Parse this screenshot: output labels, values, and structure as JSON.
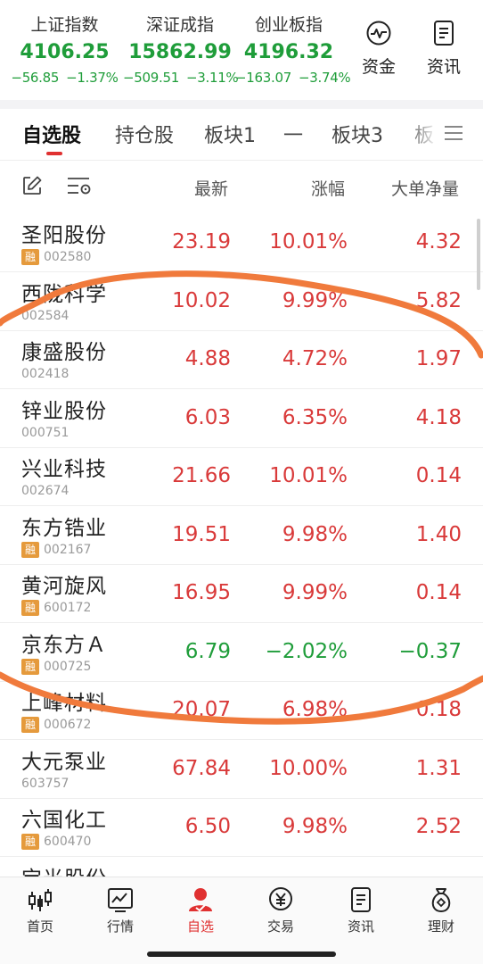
{
  "indices": [
    {
      "name": "上证指数",
      "value": "4106.25",
      "change": "−56.85",
      "pct": "−1.37%"
    },
    {
      "name": "深证成指",
      "value": "15862.99",
      "change": "−509.51",
      "pct": "−3.11%"
    },
    {
      "name": "创业板指",
      "value": "4196.32",
      "change": "−163.07",
      "pct": "−3.74%"
    }
  ],
  "quick": {
    "funds": "资金",
    "news": "资讯"
  },
  "tabs": [
    "自选股",
    "持仓股",
    "板块1",
    "一",
    "板块3",
    "板"
  ],
  "columns": {
    "latest": "最新",
    "change": "涨幅",
    "big_net": "大单净量"
  },
  "stocks": [
    {
      "name": "圣阳股份",
      "margin": "融",
      "code": "002580",
      "price": "23.19",
      "pct": "10.01%",
      "net": "4.32",
      "trend": "up"
    },
    {
      "name": "西陇科学",
      "margin": "",
      "code": "002584",
      "price": "10.02",
      "pct": "9.99%",
      "net": "5.82",
      "trend": "up"
    },
    {
      "name": "康盛股份",
      "margin": "",
      "code": "002418",
      "price": "4.88",
      "pct": "4.72%",
      "net": "1.97",
      "trend": "up"
    },
    {
      "name": "锌业股份",
      "margin": "",
      "code": "000751",
      "price": "6.03",
      "pct": "6.35%",
      "net": "4.18",
      "trend": "up"
    },
    {
      "name": "兴业科技",
      "margin": "",
      "code": "002674",
      "price": "21.66",
      "pct": "10.01%",
      "net": "0.14",
      "trend": "up"
    },
    {
      "name": "东方锆业",
      "margin": "融",
      "code": "002167",
      "price": "19.51",
      "pct": "9.98%",
      "net": "1.40",
      "trend": "up"
    },
    {
      "name": "黄河旋风",
      "margin": "融",
      "code": "600172",
      "price": "16.95",
      "pct": "9.99%",
      "net": "0.14",
      "trend": "up"
    },
    {
      "name": "京东方Ａ",
      "margin": "融",
      "code": "000725",
      "price": "6.79",
      "pct": "−2.02%",
      "net": "−0.37",
      "trend": "down"
    },
    {
      "name": "上峰材料",
      "margin": "融",
      "code": "000672",
      "price": "20.07",
      "pct": "6.98%",
      "net": "0.18",
      "trend": "up"
    },
    {
      "name": "大元泵业",
      "margin": "",
      "code": "603757",
      "price": "67.84",
      "pct": "10.00%",
      "net": "1.31",
      "trend": "up"
    },
    {
      "name": "六国化工",
      "margin": "融",
      "code": "600470",
      "price": "6.50",
      "pct": "9.98%",
      "net": "2.52",
      "trend": "up"
    },
    {
      "name": "宝光股份",
      "margin": "",
      "code": "",
      "price": "",
      "pct": "",
      "net": "",
      "trend": "up"
    }
  ],
  "nav": [
    "首页",
    "行情",
    "自选",
    "交易",
    "资讯",
    "理财"
  ],
  "colors": {
    "up": "#d93a3a",
    "down": "#1f9d3a",
    "accent": "#e03131",
    "annotation": "#f07a3c"
  }
}
